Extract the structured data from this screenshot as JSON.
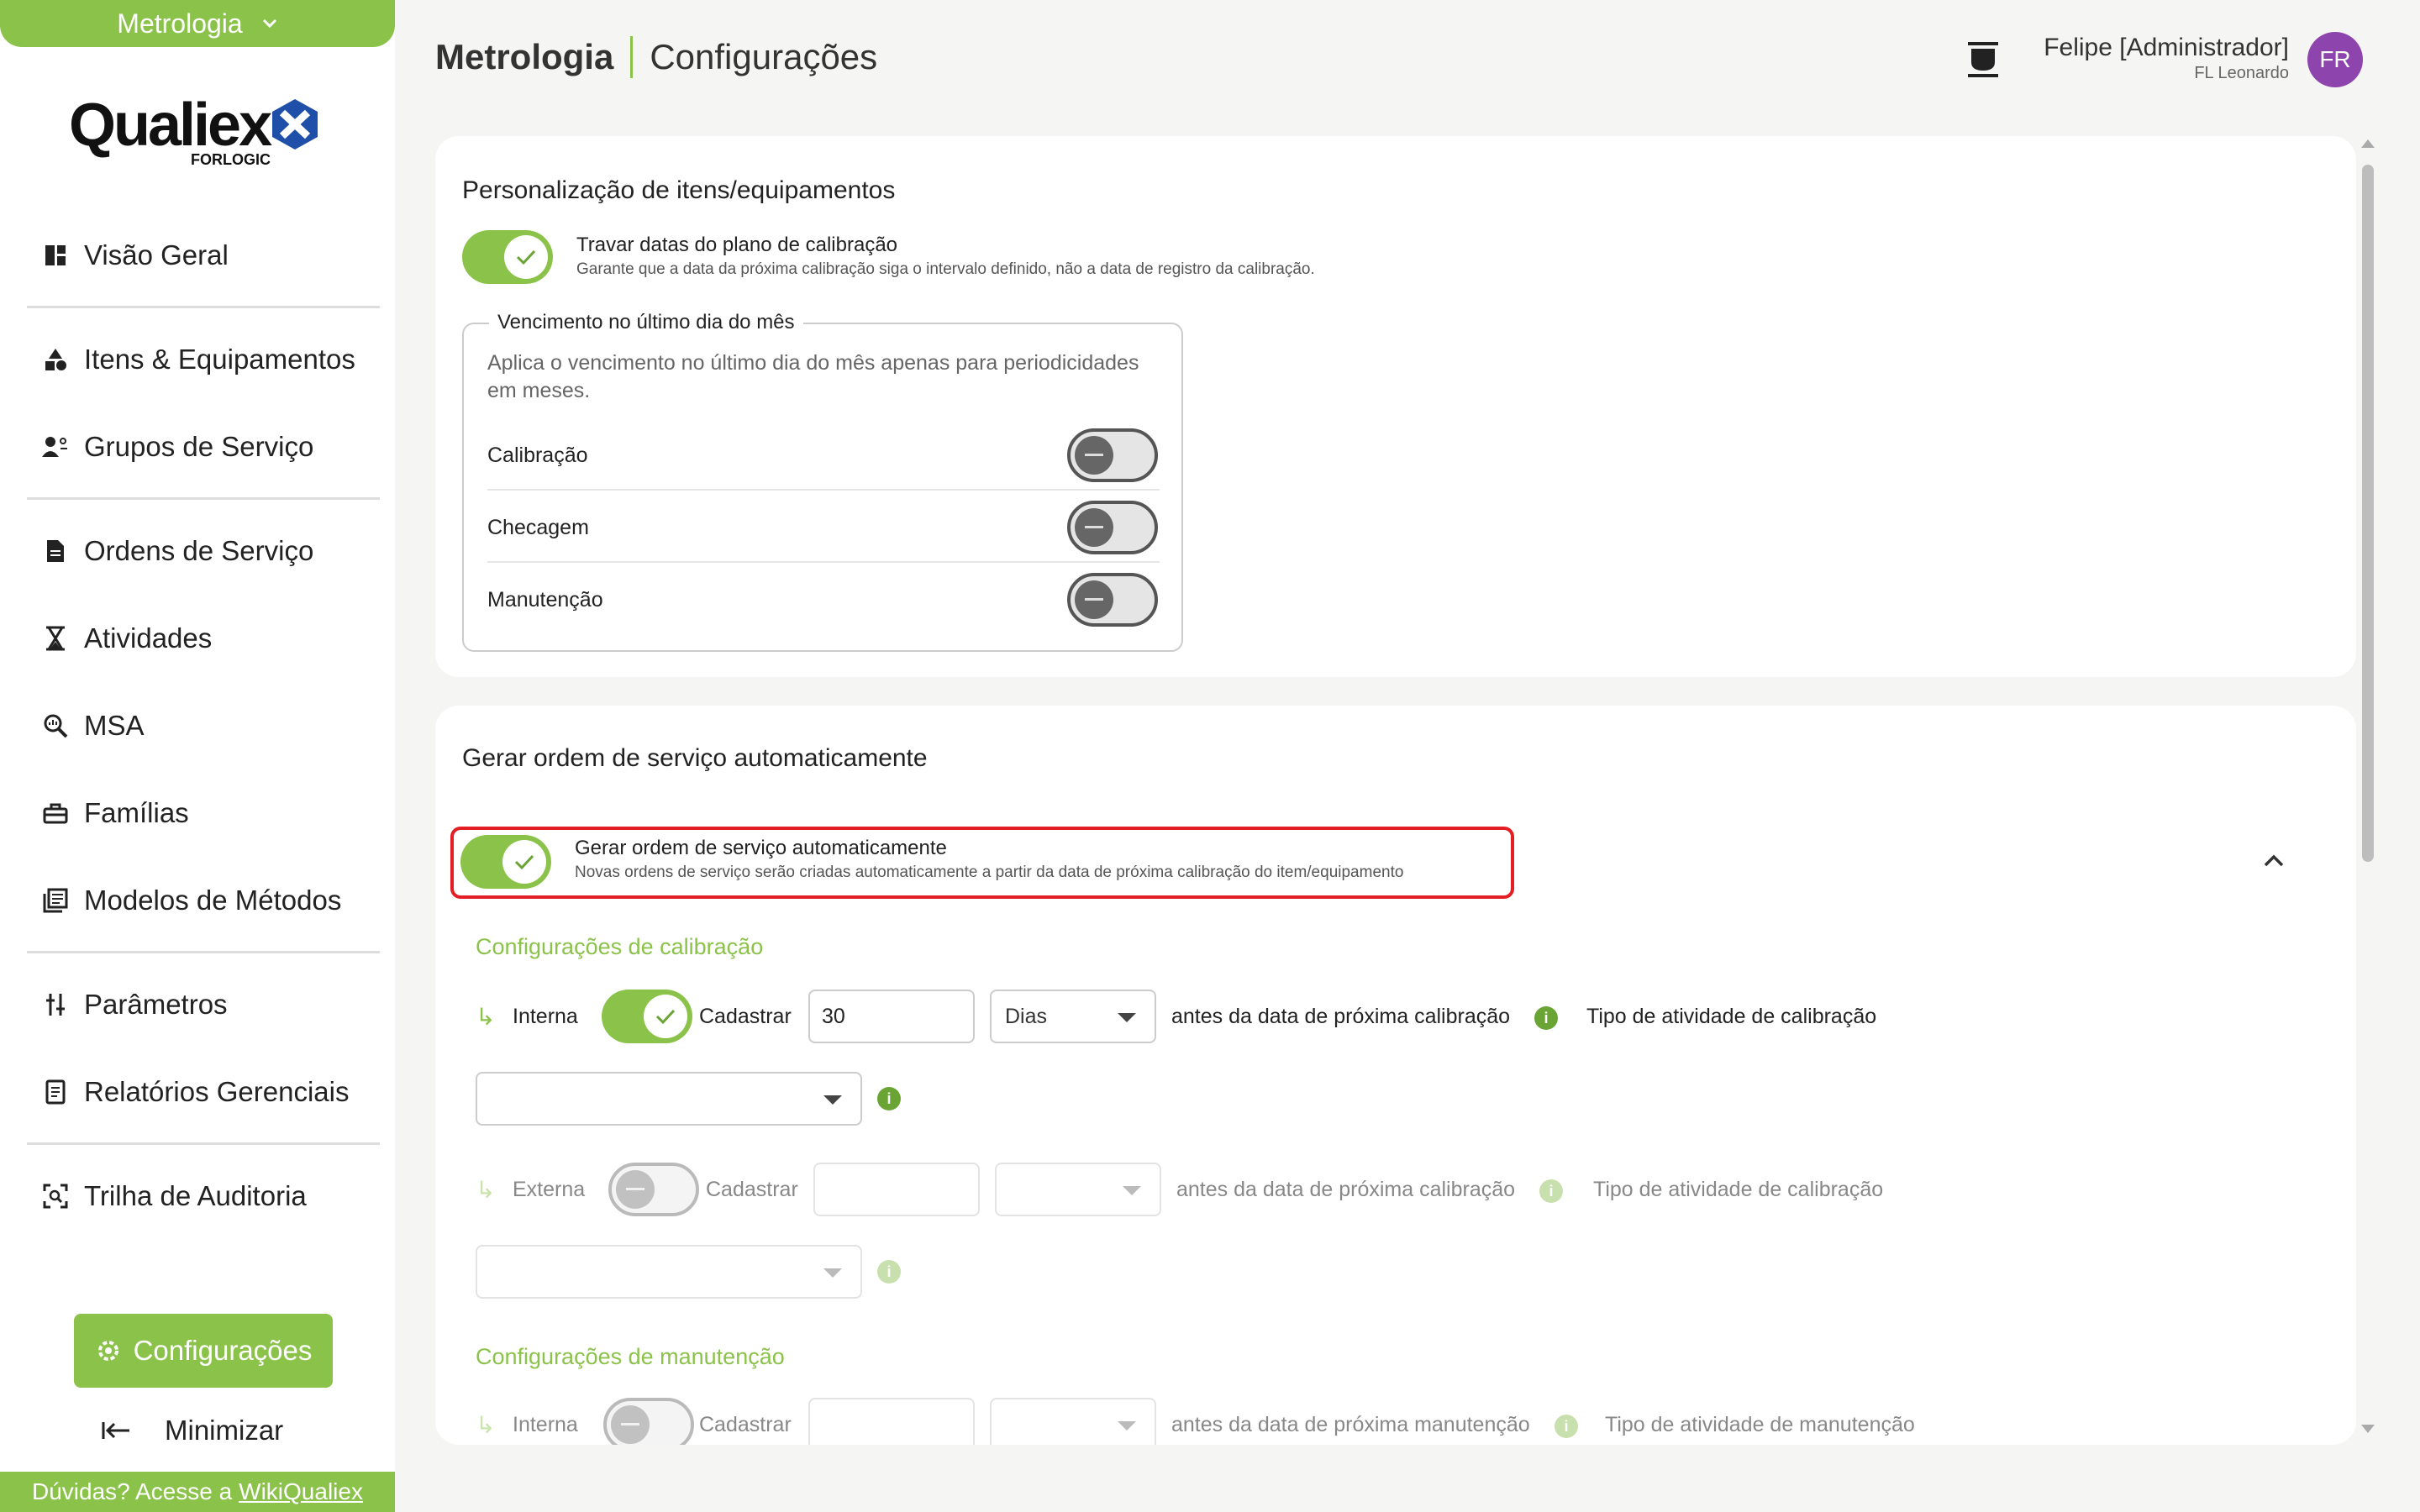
{
  "sidebar": {
    "module_label": "Metrologia",
    "logo_text": "Qualiex",
    "logo_sub": "FORLOGIC",
    "items": [
      {
        "label": "Visão Geral",
        "icon": "dashboard-icon"
      },
      {
        "label": "Itens & Equipamentos",
        "icon": "shapes-icon"
      },
      {
        "label": "Grupos de Serviço",
        "icon": "group-icon"
      },
      {
        "label": "Ordens de Serviço",
        "icon": "document-icon"
      },
      {
        "label": "Atividades",
        "icon": "hourglass-icon"
      },
      {
        "label": "MSA",
        "icon": "magnifier-icon"
      },
      {
        "label": "Famílias",
        "icon": "toolbox-icon"
      },
      {
        "label": "Modelos de Métodos",
        "icon": "library-icon"
      },
      {
        "label": "Parâmetros",
        "icon": "sliders-icon"
      },
      {
        "label": "Relatórios Gerenciais",
        "icon": "report-icon"
      },
      {
        "label": "Trilha de Auditoria",
        "icon": "audit-icon"
      }
    ],
    "settings_label": "Configurações",
    "minimize_label": "Minimizar",
    "help_text": "Dúvidas? Acesse a",
    "help_link": "WikiQualiex"
  },
  "header": {
    "module": "Metrologia",
    "page": "Configurações",
    "user_name": "Felipe [Administrador]",
    "user_org": "FL Leonardo",
    "avatar_initials": "FR"
  },
  "card1": {
    "title": "Personalização de itens/equipamentos",
    "lock_toggle": {
      "title": "Travar datas do plano de calibração",
      "desc": "Garante que a data da próxima calibração siga o intervalo definido, não a data de registro da calibração.",
      "checked": true
    },
    "fieldset": {
      "legend": "Vencimento no último dia do mês",
      "desc": "Aplica o vencimento no último dia do mês apenas para periodicidades em meses.",
      "rows": [
        {
          "label": "Calibração",
          "checked": false
        },
        {
          "label": "Checagem",
          "checked": false
        },
        {
          "label": "Manutenção",
          "checked": false
        }
      ]
    }
  },
  "card2": {
    "title": "Gerar ordem de serviço automaticamente",
    "auto_toggle": {
      "title": "Gerar ordem de serviço automaticamente",
      "desc": "Novas ordens de serviço serão criadas automaticamente a partir da data de próxima calibração do item/equipamento",
      "checked": true
    },
    "calibration": {
      "heading": "Configurações de calibração",
      "internal": {
        "label": "Interna",
        "checked": true,
        "register_label": "Cadastrar",
        "days_value": "30",
        "unit": "Dias",
        "before_text": "antes da data de próxima calibração",
        "activity_type_label": "Tipo de atividade de calibração",
        "activity_type_value": ""
      },
      "external": {
        "label": "Externa",
        "checked": false,
        "register_label": "Cadastrar",
        "days_value": "",
        "unit": "",
        "before_text": "antes da data de próxima calibração",
        "activity_type_label": "Tipo de atividade de calibração",
        "activity_type_value": ""
      }
    },
    "maintenance": {
      "heading": "Configurações de manutenção",
      "internal": {
        "label": "Interna",
        "checked": false,
        "register_label": "Cadastrar",
        "days_value": "",
        "unit": "",
        "before_text": "antes da data de próxima manutenção",
        "activity_type_label": "Tipo de atividade de manutenção"
      }
    }
  },
  "colors": {
    "accent": "#8bc34a",
    "highlight": "#e31e24",
    "avatar": "#8e44ad"
  }
}
